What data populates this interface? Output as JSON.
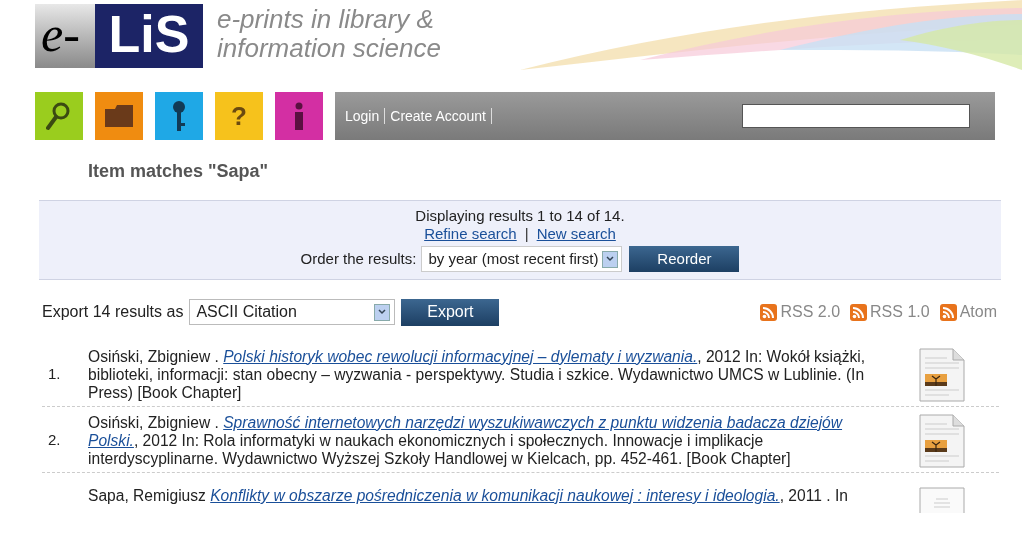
{
  "logo": {
    "prefix": "e-",
    "name": "LiS",
    "tagline_1": "e-prints in library &",
    "tagline_2": "information science"
  },
  "nav_icons": [
    {
      "kind": "search",
      "color": "#9acd1e"
    },
    {
      "kind": "folder",
      "color": "#f08c10"
    },
    {
      "kind": "key",
      "color": "#1fa8e6"
    },
    {
      "kind": "help",
      "color": "#f6c21c",
      "glyph": "?"
    },
    {
      "kind": "info",
      "color": "#d32fa3"
    }
  ],
  "menu": {
    "links": [
      "Login",
      "Create Account"
    ]
  },
  "heading": "Item matches \"Sapa\"",
  "summary": {
    "text": "Displaying results 1 to 14 of 14.",
    "links": [
      "Refine search",
      "New search"
    ],
    "separator": "|",
    "order_label": "Order the results:",
    "order_value": "by year (most recent first)",
    "reorder_button": "Reorder"
  },
  "export": {
    "label": "Export 14 results as",
    "format": "ASCII Citation",
    "button": "Export",
    "feeds": [
      "RSS 2.0",
      "RSS 1.0",
      "Atom"
    ]
  },
  "results": [
    {
      "number": "1.",
      "author": "Osiński, Zbigniew . ",
      "title": [
        "Polski historyk wobec rewolucji informacyjnej – dylematy i wyzwania."
      ],
      "details": ", 2012 In: Wokół książki, biblioteki, informacji: stan obecny – wyzwania - perspektywy. Studia i szkice. Wydawnictwo UMCS w Lublinie. (In Press) [Book Chapter]",
      "kind": "image"
    },
    {
      "number": "2.",
      "author": "Osiński, Zbigniew . ",
      "title": [
        "Sprawność internetowych narzędzi wyszukiwawczych z punktu widzenia badacza dziejów",
        "Polski."
      ],
      "details": ", 2012 In: Rola informatyki w naukach ekonomicznych i społecznych. Innowacje i implikacje interdyscyplinarne. Wydawnictwo Wyższej Szkoły Handlowej w Kielcach, pp. 452-461. [Book Chapter]",
      "kind": "image"
    },
    {
      "author": "Sapa, Remigiusz ",
      "title": [
        "Konflikty w obszarze pośredniczenia w komunikacji naukowej : interesy i ideologia."
      ],
      "details": ", 2011 . In",
      "kind": "generic"
    }
  ]
}
